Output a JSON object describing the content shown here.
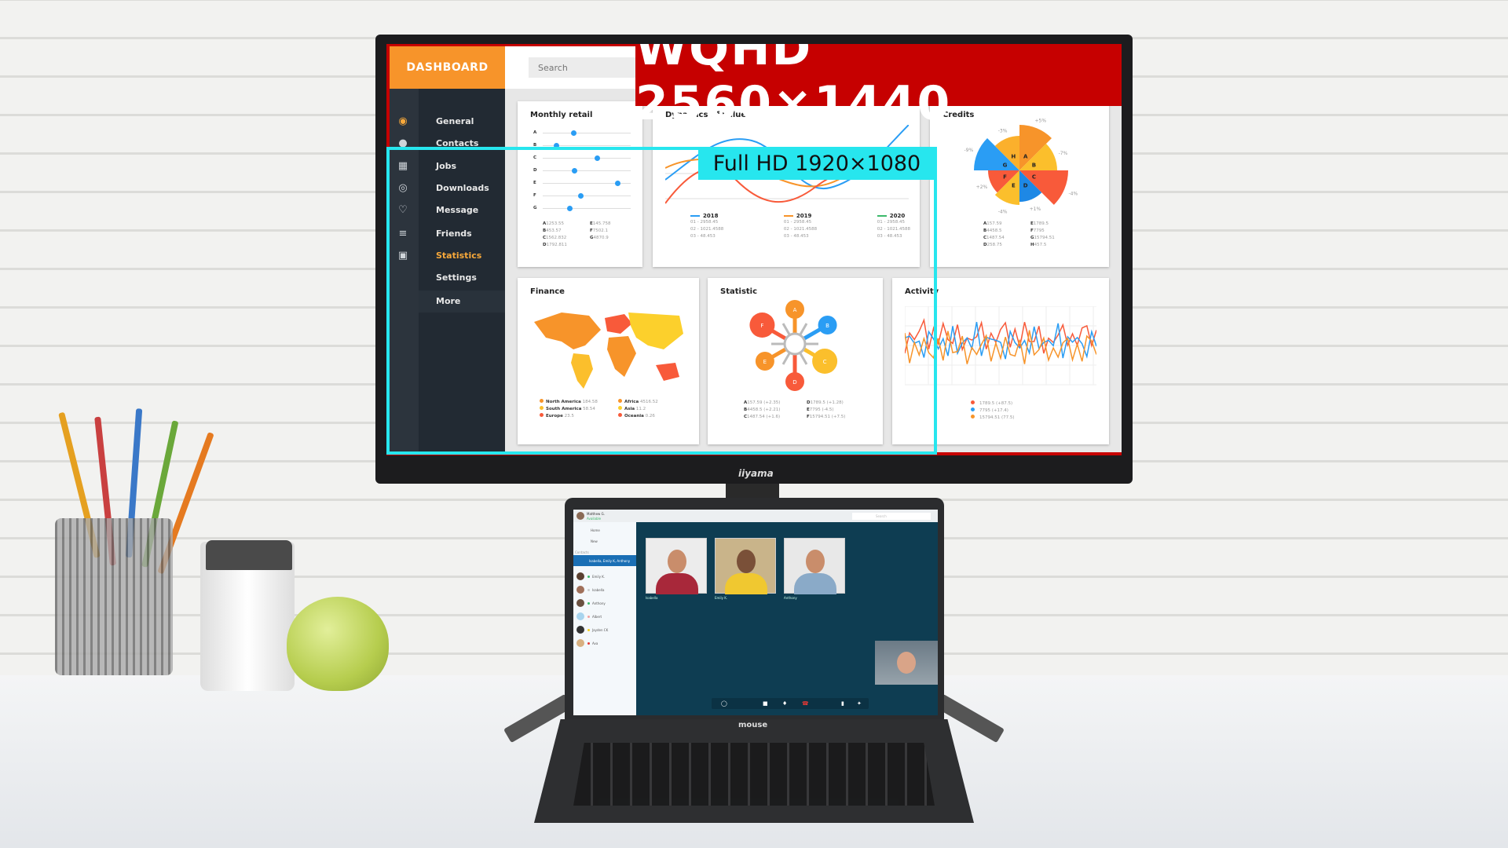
{
  "monitor": {
    "brand": "iiyama",
    "banner": "WQHD 2560×1440",
    "overlay_label": "Full HD 1920×1080",
    "colors": {
      "banner": "#c60000",
      "overlay": "#27e6ee",
      "accent": "#f7942a"
    }
  },
  "dashboard": {
    "title": "DASHBOARD",
    "search": {
      "placeholder": "Search",
      "value": ""
    },
    "sidebar": {
      "items": [
        {
          "label": "General",
          "icon": "target-icon"
        },
        {
          "label": "Contacts",
          "icon": "user-icon"
        },
        {
          "label": "Jobs",
          "icon": "map-icon"
        },
        {
          "label": "Downloads",
          "icon": "location-pin-icon"
        },
        {
          "label": "Message",
          "icon": "heart-icon"
        },
        {
          "label": "Friends",
          "icon": "sliders-icon"
        },
        {
          "label": "Statistics",
          "icon": "grid-icon",
          "active": true
        },
        {
          "label": "Settings"
        },
        {
          "label": "More"
        }
      ]
    },
    "monthly_retail": {
      "title": "Monthly retail",
      "rows": [
        {
          "label": "A",
          "level": 0.35
        },
        {
          "label": "B",
          "level": 0.15
        },
        {
          "label": "C",
          "level": 0.62
        },
        {
          "label": "D",
          "level": 0.36
        },
        {
          "label": "E",
          "level": 0.85
        },
        {
          "label": "F",
          "level": 0.43
        },
        {
          "label": "G",
          "level": 0.3
        }
      ],
      "values": [
        [
          "A",
          "1253.55"
        ],
        [
          "B",
          "453.57"
        ],
        [
          "C",
          "1562.832"
        ],
        [
          "D",
          "1792.811"
        ],
        [
          "E",
          "145.758"
        ],
        [
          "F",
          "7502.1"
        ],
        [
          "G",
          "4870.9"
        ]
      ]
    },
    "dynamics": {
      "title": "Dynamics of value",
      "legend": [
        {
          "year": "2018",
          "color": "#2a9df4",
          "lines": [
            "01 - 2958.45",
            "02 - 1021.4588",
            "03 - 48.453"
          ]
        },
        {
          "year": "2019",
          "color": "#f7942a",
          "lines": [
            "01 - 2958.45",
            "02 - 1021.4588",
            "03 - 48.453"
          ]
        },
        {
          "year": "2020",
          "color": "#3cb96b",
          "lines": [
            "01 - 2958.45",
            "02 - 1021.4588",
            "03 - 48.453"
          ]
        }
      ]
    },
    "credits": {
      "title": "Credits",
      "sectors": [
        {
          "label": "A",
          "pct": "+5%",
          "color": "#f7942a"
        },
        {
          "label": "B",
          "pct": "-7%",
          "color": "#fbbf2c"
        },
        {
          "label": "C",
          "pct": "-4%",
          "color": "#f85a3a"
        },
        {
          "label": "D",
          "pct": "+1%",
          "color": "#1e88e5"
        },
        {
          "label": "E",
          "pct": "-4%",
          "color": "#fbbf2c"
        },
        {
          "label": "F",
          "pct": "+2%",
          "color": "#f85a3a"
        },
        {
          "label": "G",
          "pct": "-9%",
          "color": "#2a9df4"
        },
        {
          "label": "H",
          "pct": "-3%",
          "color": "#fbb02c"
        }
      ],
      "values": [
        [
          "A",
          "157.59"
        ],
        [
          "B",
          "4458.5"
        ],
        [
          "C",
          "1487.54"
        ],
        [
          "D",
          "258.75"
        ],
        [
          "E",
          "1789.5"
        ],
        [
          "F",
          "7795"
        ],
        [
          "G",
          "15794.51"
        ],
        [
          "H",
          "457.5"
        ]
      ]
    },
    "finance": {
      "title": "Finance",
      "legend": [
        {
          "name": "North America",
          "value": "184.58",
          "color": "#f7942a"
        },
        {
          "name": "South America",
          "value": "58.54",
          "color": "#fbbf2c"
        },
        {
          "name": "Europe",
          "value": "23.5",
          "color": "#f85a3a"
        },
        {
          "name": "Africa",
          "value": "4516.52",
          "color": "#f7942a"
        },
        {
          "name": "Asia",
          "value": "11.2",
          "color": "#fbd02c"
        },
        {
          "name": "Oceania",
          "value": "0.26",
          "color": "#f85a3a"
        }
      ]
    },
    "statistic": {
      "title": "Statistic",
      "petals": [
        "A",
        "B",
        "C",
        "D",
        "E",
        "F"
      ],
      "values": [
        [
          "A",
          "157.59 (+2.35)"
        ],
        [
          "B",
          "4458.5 (+2.21)"
        ],
        [
          "C",
          "1487.54 (+1.6)"
        ],
        [
          "D",
          "1789.5 (+1.28)"
        ],
        [
          "E",
          "7795 (-4.5)"
        ],
        [
          "F",
          "15794.51 (+7.5)"
        ]
      ]
    },
    "activity": {
      "title": "Activity",
      "legend": [
        {
          "text": "1789.5 (+87.5)",
          "color": "#f85a3a"
        },
        {
          "text": "7795 (+17.4)",
          "color": "#2a9df4"
        },
        {
          "text": "15794.51 (77.5)",
          "color": "#f7942a"
        }
      ]
    }
  },
  "laptop": {
    "brand": "mouse",
    "user": {
      "name": "Matthew G.",
      "status": "Available"
    },
    "search_placeholder": "Search",
    "nav": [
      "Home",
      "New"
    ],
    "section": "Contacts",
    "active_chat": "Isabella, Emily K, Anthony",
    "contacts": [
      {
        "name": "Emily K.",
        "status": "#3cb96b"
      },
      {
        "name": "Isabella",
        "status": "#cccccc"
      },
      {
        "name": "Anthony",
        "status": "#3cb96b"
      },
      {
        "name": "Albert",
        "status": "#f0a0a0"
      },
      {
        "name": "Jayden CK",
        "status": "#f5d020"
      },
      {
        "name": "Ava",
        "status": "#e53935"
      }
    ],
    "participants": [
      "Isabella",
      "Emily K.",
      "Anthony"
    ]
  }
}
